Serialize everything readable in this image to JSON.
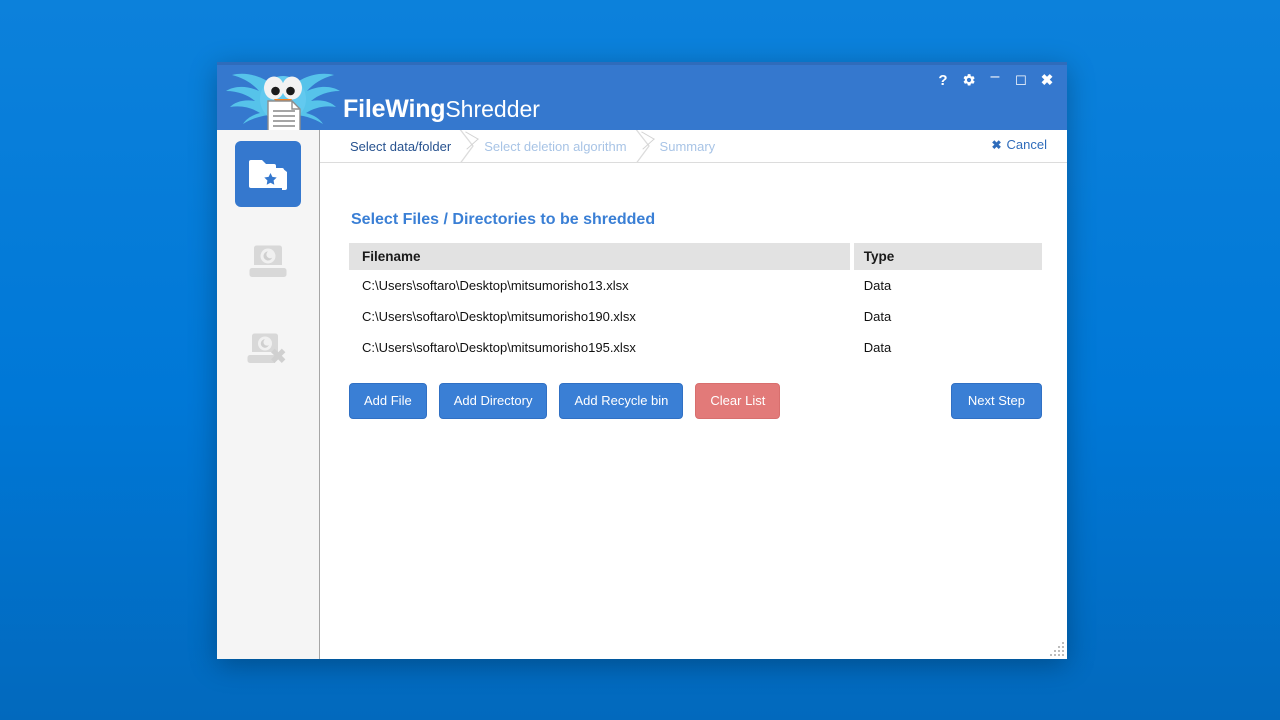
{
  "window": {
    "app_name_bold": "FileWing",
    "app_name_light": "Shredder",
    "controls": {
      "help": "?",
      "settings": "settings-gear",
      "minimize": "–",
      "maximize": "☐",
      "close": "✖"
    }
  },
  "sidebar": {
    "items": [
      {
        "name": "shred-files-folders",
        "icon": "folder-star-icon",
        "active": true
      },
      {
        "name": "shred-drive",
        "icon": "disk-drive-icon",
        "active": false
      },
      {
        "name": "shred-free-space",
        "icon": "disk-drive-delete-icon",
        "active": false
      }
    ]
  },
  "steps": {
    "items": [
      {
        "label": "Select data/folder",
        "state": "current"
      },
      {
        "label": "Select deletion algorithm",
        "state": "future"
      },
      {
        "label": "Summary",
        "state": "future"
      }
    ],
    "cancel_label": "Cancel",
    "cancel_icon": "✖"
  },
  "main": {
    "title": "Select Files / Directories to be shredded",
    "table": {
      "columns": [
        "Filename",
        "Type"
      ],
      "rows": [
        {
          "filename": "C:\\Users\\softaro\\Desktop\\mitsumorisho13.xlsx",
          "type": "Data"
        },
        {
          "filename": "C:\\Users\\softaro\\Desktop\\mitsumorisho190.xlsx",
          "type": "Data"
        },
        {
          "filename": "C:\\Users\\softaro\\Desktop\\mitsumorisho195.xlsx",
          "type": "Data"
        }
      ]
    },
    "buttons": {
      "add_file": "Add File",
      "add_directory": "Add Directory",
      "add_recycle_bin": "Add Recycle bin",
      "clear_list": "Clear List",
      "next_step": "Next Step"
    }
  },
  "colors": {
    "desktop": "#0078d7",
    "header": "#3578ce",
    "accent": "#3a7fd5",
    "danger": "#e27a79",
    "sidebar": "#f5f5f5",
    "table_header": "#e2e2e2"
  }
}
